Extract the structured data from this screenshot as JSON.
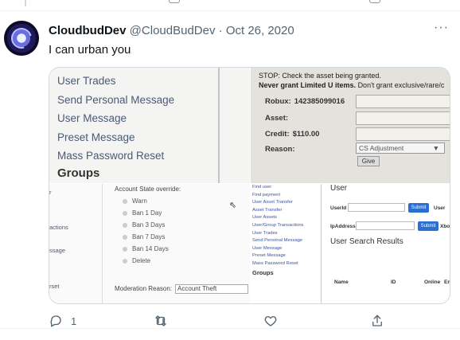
{
  "tweet": {
    "display_name": "CloudbudDev",
    "handle": "@CloudBudDev",
    "separator": "·",
    "date": "Oct 26, 2020",
    "text": "I can urban you",
    "more_label": "···",
    "reply_count": "1"
  },
  "media": {
    "admin_menu": {
      "items": [
        "User Trades",
        "Send Personal Message",
        "User Message",
        "Preset Message",
        "Mass Password Reset"
      ],
      "section": "Groups"
    },
    "grant_panel": {
      "warning_1": "STOP: Check the asset being granted.",
      "warning_2_bold": "Never grant Limited U items.",
      "warning_2_rest": "Don't grant exclusive/rare/c",
      "robux_label": "Robux:",
      "robux_value": "142385099016",
      "asset_label": "Asset:",
      "credit_label": "Credit:",
      "credit_value": "$110.00",
      "reason_label": "Reason:",
      "reason_value": "CS Adjustment",
      "give_label": "Give"
    },
    "moderation": {
      "left_items": [
        "r",
        "actions",
        "ssage",
        "rset"
      ],
      "title": "Account State override:",
      "options": [
        "Warn",
        "Ban 1 Day",
        "Ban 3 Days",
        "Ban 7 Days",
        "Ban 14 Days",
        "Delete"
      ],
      "reason_label": "Moderation Reason:",
      "reason_value": "Account Theft"
    },
    "user_search": {
      "links": [
        "Find user",
        "Find payment",
        "User Asset Transfer",
        "Asset Transfer",
        "User Assets",
        "User/Group Transactions",
        "User Trades",
        "Send Personal Message",
        "User Message",
        "Preset Message",
        "Mass Password Reset"
      ],
      "groups": "Groups",
      "header": "User",
      "userid_label": "UserId",
      "ip_label": "IpAddress",
      "submit_label": "Submit",
      "user_col_cut": "User",
      "xbox_col_cut": "Xbo",
      "results_title": "User Search Results",
      "table_headers": [
        "Name",
        "ID",
        "Online",
        "Em"
      ]
    }
  },
  "colors": {
    "text_primary": "#0f1419",
    "text_secondary": "#536471",
    "border": "#cfd9de",
    "submit_blue": "#2b6fd1"
  },
  "icons": [
    "reply-icon",
    "retweet-icon",
    "like-icon",
    "share-icon",
    "more-icon",
    "cursor-icon"
  ]
}
